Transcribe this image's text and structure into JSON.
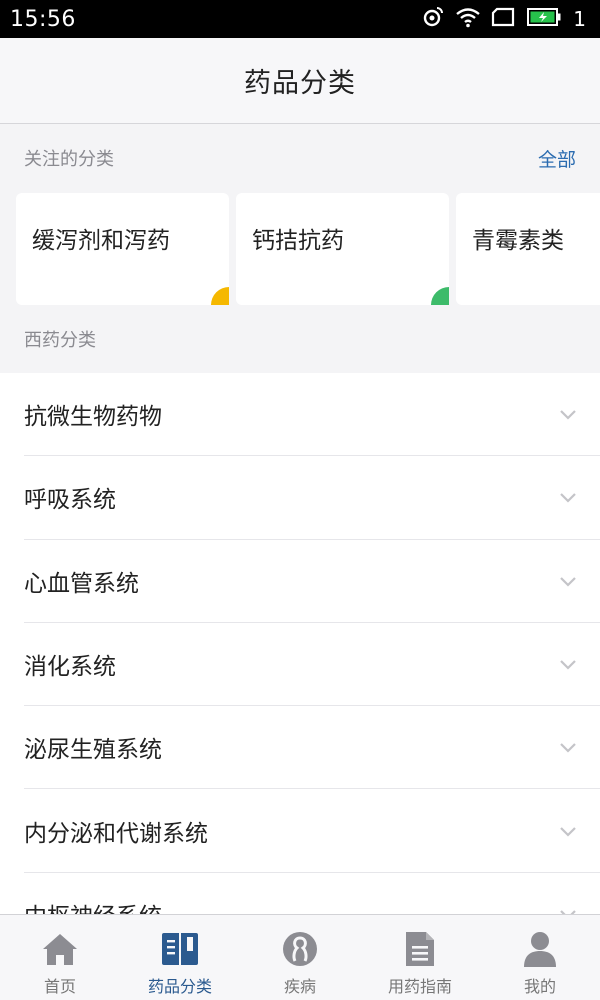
{
  "status_bar": {
    "time": "15:56",
    "signal_number": "1"
  },
  "header": {
    "title": "药品分类"
  },
  "followed": {
    "label": "关注的分类",
    "link": "全部",
    "cards": [
      {
        "label": "缓泻剂和泻药",
        "accent": "#f5b800"
      },
      {
        "label": "钙拮抗药",
        "accent": "#3dbb6a"
      },
      {
        "label": "青霉素类",
        "accent": "#2b6cb0"
      }
    ]
  },
  "western": {
    "label": "西药分类",
    "items": [
      {
        "label": "抗微生物药物"
      },
      {
        "label": "呼吸系统"
      },
      {
        "label": "心血管系统"
      },
      {
        "label": "消化系统"
      },
      {
        "label": "泌尿生殖系统"
      },
      {
        "label": "内分泌和代谢系统"
      },
      {
        "label": "中枢神经系统"
      }
    ]
  },
  "tabs": [
    {
      "label": "首页",
      "icon": "home-icon",
      "active": false
    },
    {
      "label": "药品分类",
      "icon": "book-icon",
      "active": true
    },
    {
      "label": "疾病",
      "icon": "disease-icon",
      "active": false
    },
    {
      "label": "用药指南",
      "icon": "document-icon",
      "active": false
    },
    {
      "label": "我的",
      "icon": "person-icon",
      "active": false
    }
  ],
  "colors": {
    "accent": "#2b6cb0",
    "active_tab": "#2b5a8f",
    "inactive_icon": "#8c8c92"
  }
}
